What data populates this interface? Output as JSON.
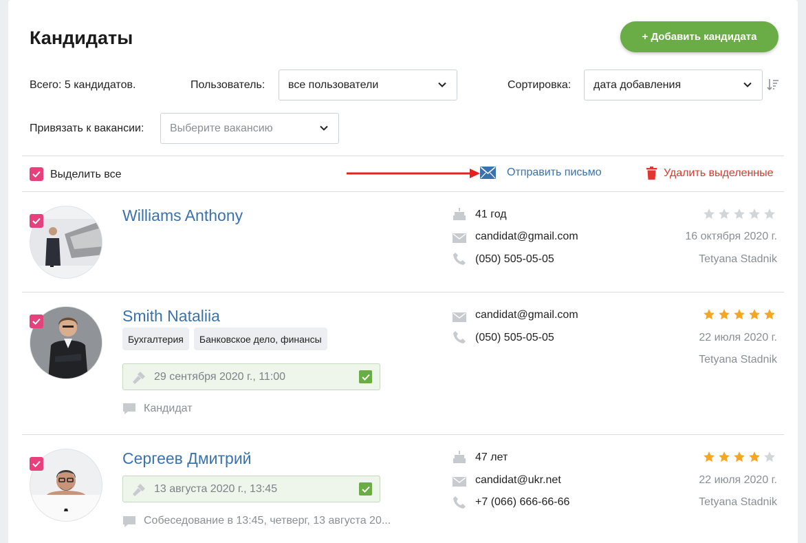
{
  "page": {
    "title": "Кандидаты",
    "add_button": "+ Добавить кандидата"
  },
  "filters": {
    "total": "Всего: 5 кандидатов.",
    "user_label": "Пользователь:",
    "user_value": "все пользователи",
    "sort_label": "Сортировка:",
    "sort_value": "дата добавления",
    "vacancy_label": "Привязать к вакансии:",
    "vacancy_placeholder": "Выберите вакансию"
  },
  "bulk": {
    "select_all": "Выделить все",
    "send_email": "Отправить письмо",
    "delete_selected": "Удалить выделенные"
  },
  "colors": {
    "accent_green": "#6aac45",
    "link_blue": "#3a72ad",
    "checkbox_pink": "#e8407c",
    "delete_red": "#e0362f",
    "star_gold": "#f5a623",
    "star_grey": "#d3d6d9"
  },
  "candidates": [
    {
      "name": "Williams Anthony",
      "age": "41 год",
      "email": "candidat@gmail.com",
      "phone": "(050) 505-05-05",
      "rating": 0,
      "date": "16 октября 2020 г.",
      "owner": "Tetyana Stadnik",
      "checked": true
    },
    {
      "name": "Smith Nataliia",
      "tags": [
        "Бухгалтерия",
        "Банковское дело, финансы"
      ],
      "event": "29 сентября 2020 г., 11:00",
      "note": "Кандидат",
      "email": "candidat@gmail.com",
      "phone": "(050) 505-05-05",
      "rating": 5,
      "date": "22 июля 2020 г.",
      "owner": "Tetyana Stadnik",
      "checked": true
    },
    {
      "name": "Сергеев Дмитрий",
      "event": "13 августа 2020 г., 13:45",
      "note": "Собеседование в 13:45, четверг, 13 августа 20...",
      "age": "47 лет",
      "email": "candidat@ukr.net",
      "phone": "+7 (066) 666-66-66",
      "rating": 4,
      "date": "22 июля 2020 г.",
      "owner": "Tetyana Stadnik",
      "checked": true
    }
  ]
}
